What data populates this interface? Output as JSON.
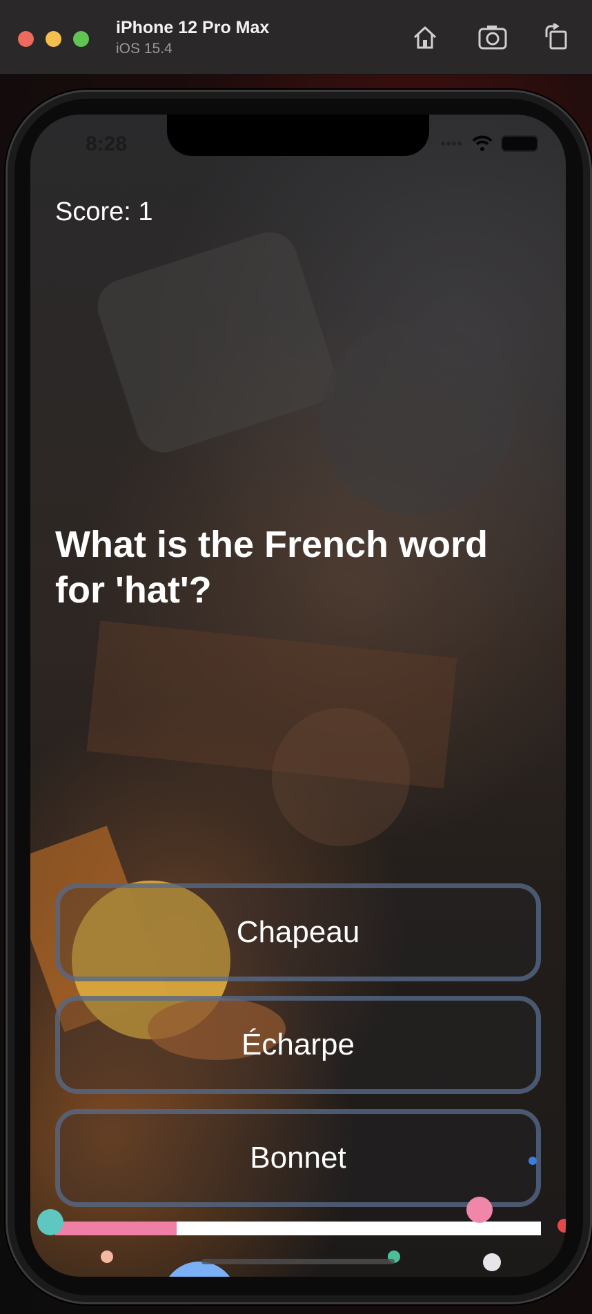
{
  "simulator": {
    "device_name": "iPhone 12 Pro Max",
    "os_version": "iOS 15.4",
    "icons": [
      "home-icon",
      "screenshot-icon",
      "rotate-icon"
    ]
  },
  "status_bar": {
    "time": "8:28",
    "icons": [
      "signal-icon",
      "wifi-icon",
      "battery-icon"
    ]
  },
  "quiz": {
    "score_label": "Score: 1",
    "question": "What is the French word for 'hat'?",
    "answers": [
      "Chapeau",
      "Écharpe",
      "Bonnet"
    ],
    "timer_progress": 0.25
  },
  "colors": {
    "timer_fill": "#ef7fa4",
    "timer_track": "#ffffff",
    "answer_border": "#5a6e8c",
    "confetti": [
      "#5ec8c0",
      "#f5b8a0",
      "#4cbf9a",
      "#e6e6ea",
      "#f087a8",
      "#3a7ddc",
      "#7ab0f5",
      "#e24a4a",
      "#d9a63c"
    ]
  }
}
